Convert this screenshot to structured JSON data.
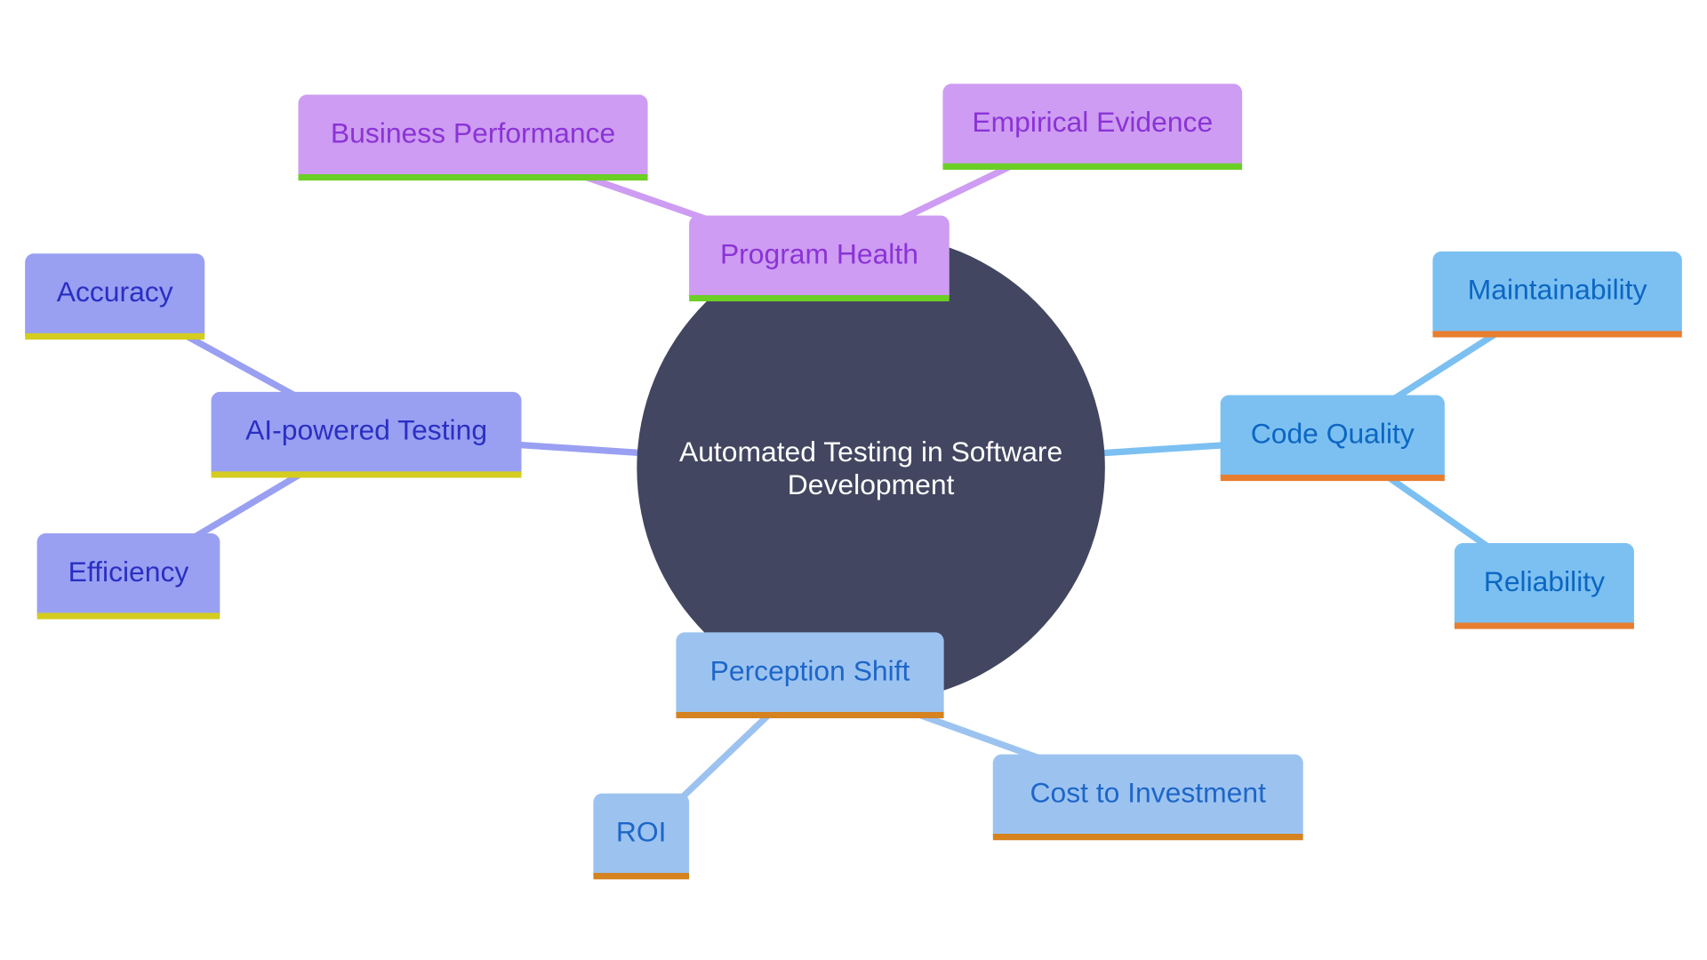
{
  "diagram": {
    "type": "mindmap",
    "center": {
      "label": "Automated Testing in Software Development"
    },
    "colors": {
      "center_fill": "#424660",
      "center_text": "#ffffff",
      "purple": {
        "fill": "#CE9CF2",
        "text": "#8A33D6",
        "underline": "#6BCF25",
        "edge": "#CE9CF2"
      },
      "indigo": {
        "fill": "#99A0F2",
        "text": "#2A2FC2",
        "underline": "#D4CC1E",
        "edge": "#99A0F2"
      },
      "sky": {
        "fill": "#7CC0F2",
        "text": "#0C66C2",
        "underline": "#E87E2F",
        "edge": "#7CC0F2"
      },
      "light": {
        "fill": "#9CC3F0",
        "text": "#1E66C8",
        "underline": "#D5821F",
        "edge": "#9CC3F0"
      }
    },
    "branches": [
      {
        "id": "program-health",
        "label": "Program Health",
        "palette": "purple",
        "children": [
          {
            "id": "business-performance",
            "label": "Business Performance"
          },
          {
            "id": "empirical-evidence",
            "label": "Empirical Evidence"
          }
        ]
      },
      {
        "id": "ai-powered-testing",
        "label": "AI-powered Testing",
        "palette": "indigo",
        "children": [
          {
            "id": "accuracy",
            "label": "Accuracy"
          },
          {
            "id": "efficiency",
            "label": "Efficiency"
          }
        ]
      },
      {
        "id": "code-quality",
        "label": "Code Quality",
        "palette": "sky",
        "children": [
          {
            "id": "maintainability",
            "label": "Maintainability"
          },
          {
            "id": "reliability",
            "label": "Reliability"
          }
        ]
      },
      {
        "id": "perception-shift",
        "label": "Perception Shift",
        "palette": "light",
        "children": [
          {
            "id": "roi",
            "label": "ROI"
          },
          {
            "id": "cost-to-investment",
            "label": "Cost to Investment"
          }
        ]
      }
    ]
  }
}
